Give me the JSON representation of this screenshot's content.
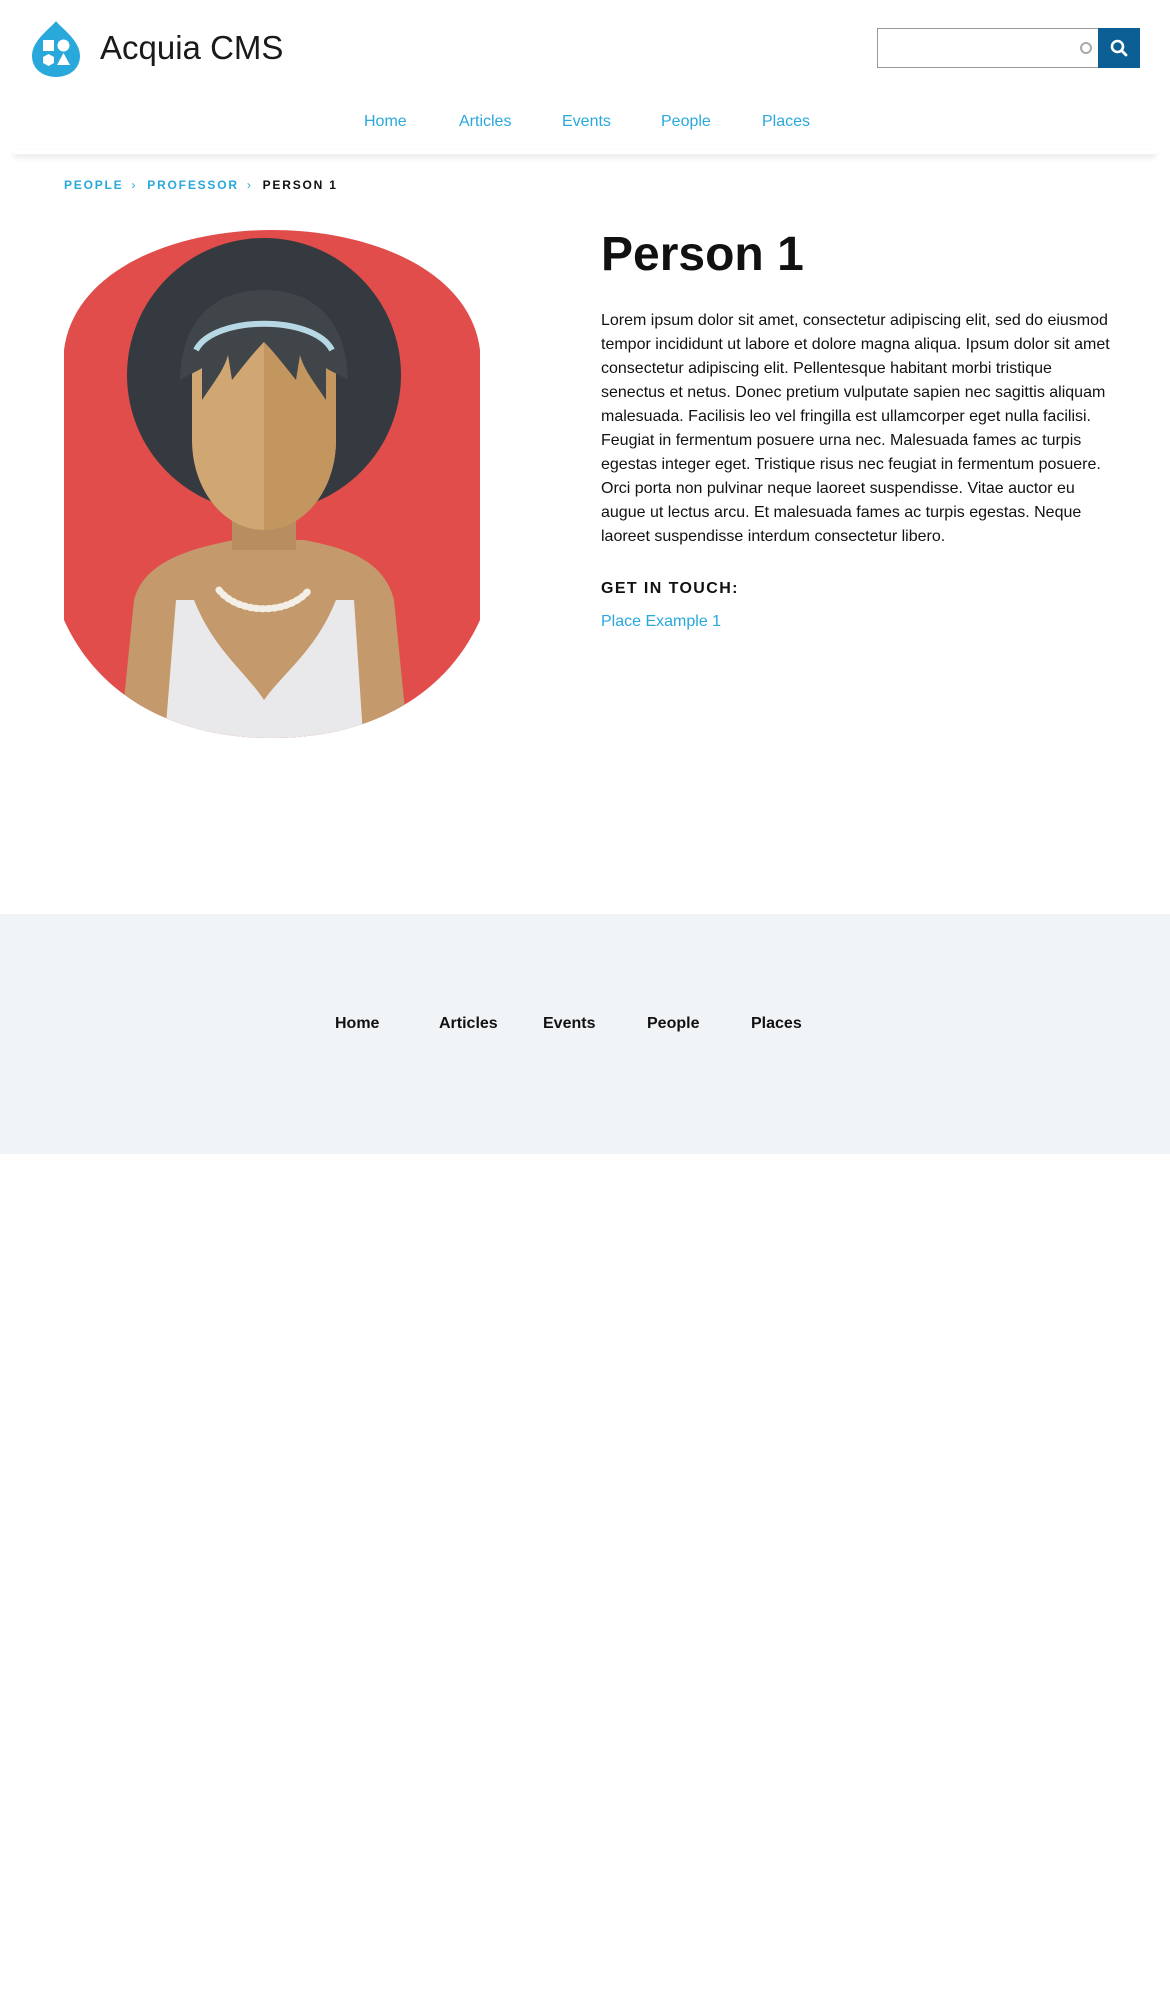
{
  "header": {
    "site_name": "Acquia CMS",
    "search": {
      "value": "",
      "placeholder": ""
    }
  },
  "main_nav": [
    "Home",
    "Articles",
    "Events",
    "People",
    "Places"
  ],
  "breadcrumb": {
    "items": [
      "PEOPLE",
      "PROFESSOR"
    ],
    "current": "PERSON 1"
  },
  "person": {
    "name": "Person 1",
    "bio": "Lorem ipsum dolor sit amet, consectetur adipiscing elit, sed do eiusmod tempor incididunt ut labore et dolore magna aliqua. Ipsum dolor sit amet consectetur adipiscing elit. Pellentesque habitant morbi tristique senectus et netus. Donec pretium vulputate sapien nec sagittis aliquam malesuada. Facilisis leo vel fringilla est ullamcorper eget nulla facilisi. Feugiat in fermentum posuere urna nec. Malesuada fames ac turpis egestas integer eget. Tristique risus nec feugiat in fermentum posuere. Orci porta non pulvinar neque laoreet suspendisse. Vitae auctor eu augue ut lectus arcu. Et malesuada fames ac turpis egestas. Neque laoreet suspendisse interdum consectetur libero.",
    "get_in_touch_label": "GET IN TOUCH:",
    "place_link": "Place Example 1"
  },
  "footer_nav": [
    "Home",
    "Articles",
    "Events",
    "People",
    "Places"
  ],
  "colors": {
    "link": "#29a8dc",
    "search_button": "#0b5f95",
    "footer_bg": "#f1f4f7",
    "avatar_bg": "#e04d4a"
  },
  "icons": {
    "logo": "drupal-drop-logo",
    "search": "search-icon"
  }
}
